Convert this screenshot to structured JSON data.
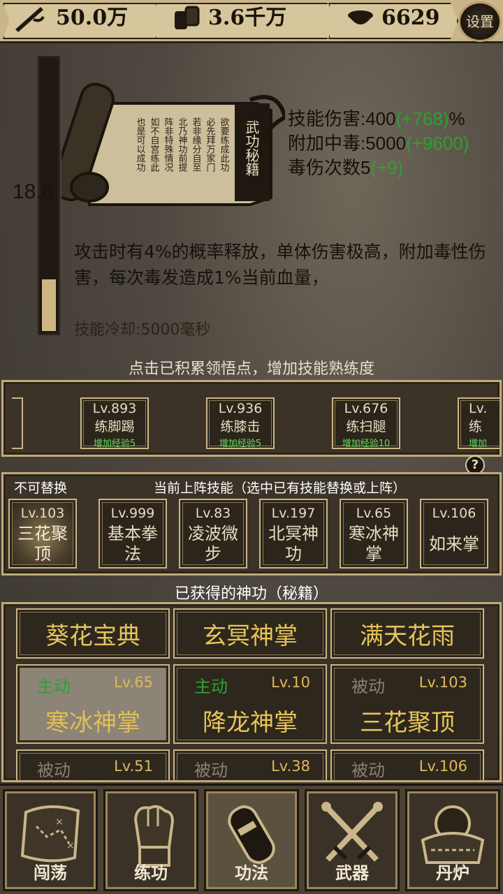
{
  "resources": {
    "power": {
      "value": "50.0万",
      "icon": "sword-icon"
    },
    "money": {
      "value": "3.6千万",
      "icon": "coins-icon"
    },
    "ingot": {
      "value": "6629",
      "icon": "ingot-icon"
    }
  },
  "settings_label": "设置",
  "skill": {
    "mastery_value": "18.6",
    "mastery_fill_fraction": 0.19,
    "book_title": "武功秘籍",
    "scroll_text": [
      "欲要练成此功",
      "必先拜万家门",
      "若非缘分自至",
      "北乃神功前提",
      "阵非特殊情况",
      "如不自宫练此",
      "也是可以成功"
    ],
    "stats": [
      {
        "label": "技能伤害:400",
        "bonus": "(+768)",
        "suffix": "%"
      },
      {
        "label": "附加中毒:5000",
        "bonus": "(+9600)",
        "suffix": ""
      },
      {
        "label": "毒伤次数5",
        "bonus": "(+9)",
        "suffix": ""
      }
    ],
    "description": "攻击时有4%的概率释放，单体伤害极高，附加毒性伤害，每次毒发造成1%当前血量，",
    "cooldown": "技能冷却:5000毫秒"
  },
  "hint": "点击已积累领悟点，增加技能熟练度",
  "mastery_cards": [
    {
      "level": "Lv.893",
      "name": "练脚踢",
      "exp": "增加经验5"
    },
    {
      "level": "Lv.936",
      "name": "练膝击",
      "exp": "增加经验5"
    },
    {
      "level": "Lv.676",
      "name": "练扫腿",
      "exp": "增加经验10"
    },
    {
      "level": "Lv.",
      "name": "练",
      "exp": "增加"
    }
  ],
  "help_icon": "?",
  "active": {
    "not_replaceable": "不可替换",
    "title": "当前上阵技能（选中已有技能替换或上阵）",
    "slots": [
      {
        "level": "Lv.103",
        "name": "三花聚顶"
      },
      {
        "level": "Lv.999",
        "name": "基本拳法"
      },
      {
        "level": "Lv.83",
        "name": "凌波微步"
      },
      {
        "level": "Lv.197",
        "name": "北冥神功"
      },
      {
        "level": "Lv.65",
        "name": "寒冰神掌"
      },
      {
        "level": "Lv.106",
        "name": "如来掌"
      }
    ]
  },
  "acquired": {
    "title": "已获得的神功（秘籍）",
    "row1": [
      "葵花宝典",
      "玄冥神掌",
      "满天花雨"
    ],
    "row2": [
      {
        "type": "主动",
        "level": "Lv.65",
        "name": "寒冰神掌"
      },
      {
        "type": "主动",
        "level": "Lv.10",
        "name": "降龙神掌"
      },
      {
        "type": "被动",
        "level": "Lv.103",
        "name": "三花聚顶"
      }
    ],
    "row3": [
      {
        "type": "被动",
        "level": "Lv.51"
      },
      {
        "type": "被动",
        "level": "Lv.38"
      },
      {
        "type": "被动",
        "level": "Lv.106"
      }
    ]
  },
  "nav": [
    {
      "label": "闯荡",
      "icon": "map-icon"
    },
    {
      "label": "练功",
      "icon": "fist-icon"
    },
    {
      "label": "功法",
      "icon": "scroll-icon"
    },
    {
      "label": "武器",
      "icon": "swords-icon"
    },
    {
      "label": "丹炉",
      "icon": "cauldron-icon"
    }
  ],
  "colors": {
    "bonus": "#2ea034",
    "gold_text": "#e7c45a",
    "active_type": "#2ea036",
    "frame": "#c2aa78"
  }
}
